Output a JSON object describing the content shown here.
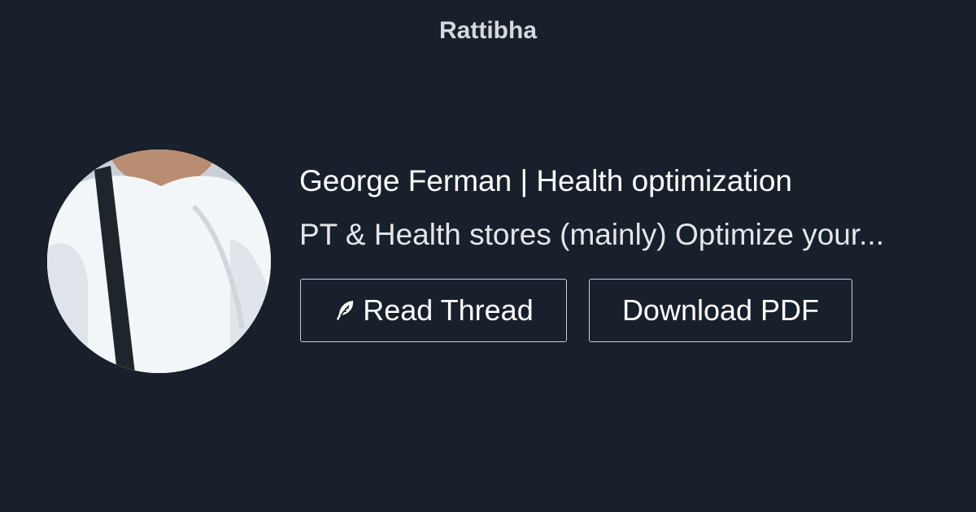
{
  "brand": {
    "name": "Rattibha"
  },
  "profile": {
    "title": "George Ferman | Health optimization",
    "description": "PT & Health stores (mainly) Optimize your..."
  },
  "actions": {
    "read_thread": {
      "label": "Read Thread",
      "icon": "feather-icon"
    },
    "download_pdf": {
      "label": "Download PDF"
    }
  },
  "colors": {
    "background": "#18202b",
    "text": "#ffffff",
    "button_border": "#c7ccd2"
  }
}
